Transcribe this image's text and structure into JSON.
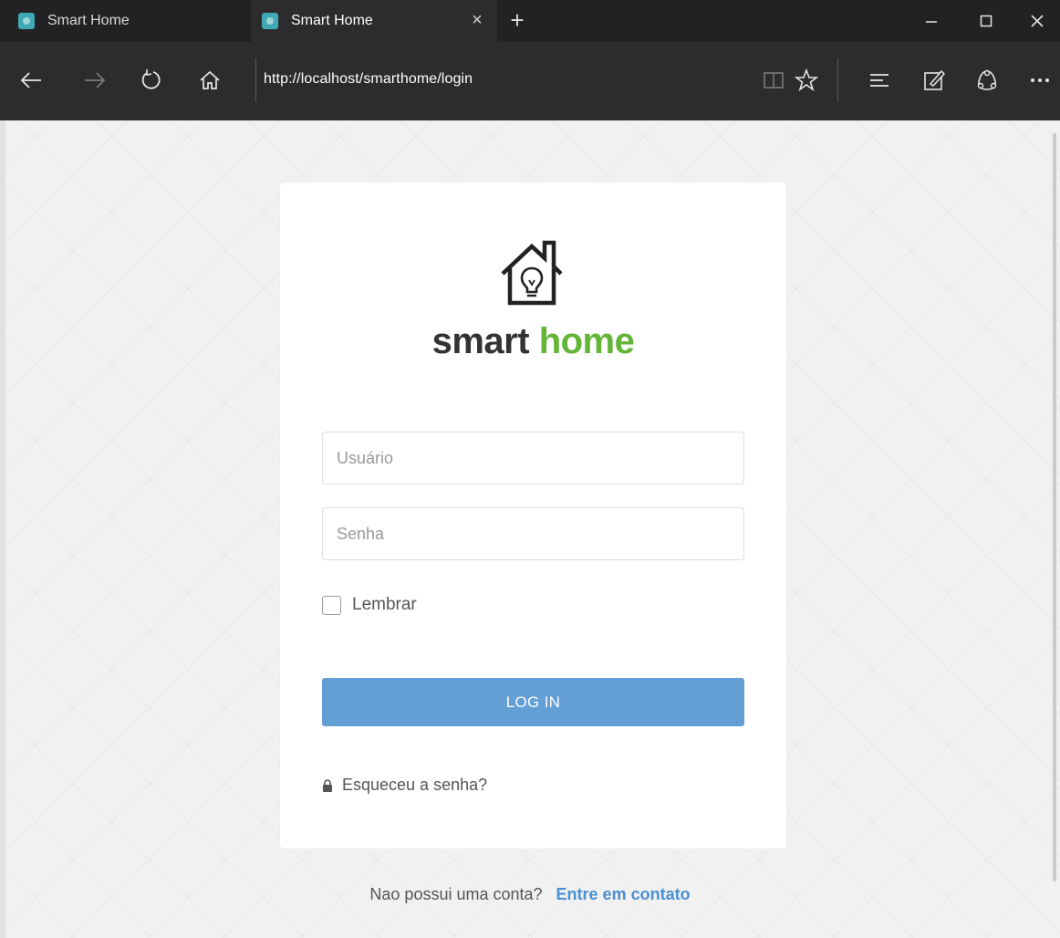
{
  "browser": {
    "tabs": [
      {
        "title": "Smart Home",
        "active": false
      },
      {
        "title": "Smart Home",
        "active": true
      }
    ],
    "close_tab_glyph": "×",
    "new_tab_glyph": "+",
    "window_controls": {
      "minimize": "–",
      "maximize": "☐",
      "close": "✕"
    },
    "url": "http://localhost/smarthome/login",
    "nav_icons": [
      "back-arrow-icon",
      "forward-arrow-icon",
      "refresh-icon",
      "home-icon"
    ],
    "toolbar_icons": [
      "reading-view-icon",
      "favorite-star-icon",
      "hub-icon",
      "web-note-icon",
      "share-icon",
      "more-icon"
    ]
  },
  "login": {
    "logo_icon": "house-lightbulb-icon",
    "brand_word_1": "smart",
    "brand_word_2": "home",
    "username_placeholder": "Usuário",
    "password_placeholder": "Senha",
    "remember_label": "Lembrar",
    "login_button": "LOG IN",
    "forgot_label": "Esqueceu a senha?",
    "no_account_text": "Nao possui uma conta?",
    "contact_link": "Entre em contato"
  },
  "colors": {
    "chrome_dark": "#222225",
    "chrome_bar": "#2c2c2f",
    "brand_green": "#62b536",
    "button_blue": "#639ed4",
    "link_blue": "#4a8fd0"
  }
}
